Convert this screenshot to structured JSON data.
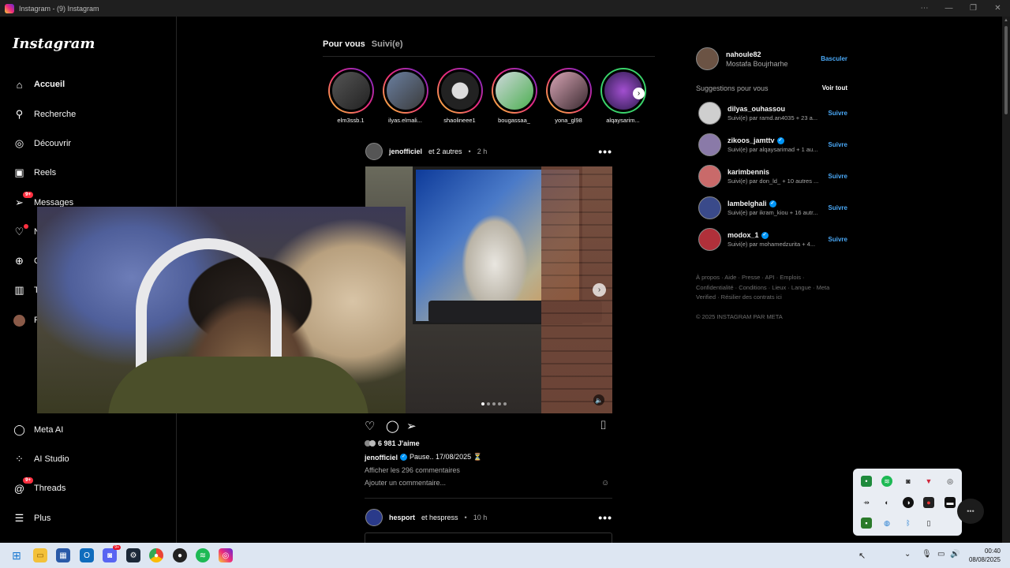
{
  "window": {
    "title": "Instagram - (9) Instagram"
  },
  "brand": {
    "logo": "Instagram",
    "accent": "#0095f6",
    "badge_color": "#ff3040"
  },
  "nav": {
    "items": [
      {
        "label": "Accueil",
        "icon": "home-icon"
      },
      {
        "label": "Recherche",
        "icon": "search-icon"
      },
      {
        "label": "Découvrir",
        "icon": "compass-icon"
      },
      {
        "label": "Reels",
        "icon": "reels-icon"
      },
      {
        "label": "Messages",
        "icon": "messages-icon",
        "badge": "9+"
      },
      {
        "label": "N",
        "icon": "heart-icon"
      },
      {
        "label": "C",
        "icon": "create-icon"
      },
      {
        "label": "T",
        "icon": "dashboard-icon"
      },
      {
        "label": "P",
        "icon": "profile-avatar"
      }
    ],
    "bottom": [
      {
        "label": "Meta AI",
        "icon": "meta-ai-icon"
      },
      {
        "label": "AI Studio",
        "icon": "ai-studio-icon"
      },
      {
        "label": "Threads",
        "icon": "threads-icon",
        "badge": "9+"
      },
      {
        "label": "Plus",
        "icon": "menu-icon"
      }
    ]
  },
  "feed": {
    "tabs": [
      "Pour vous",
      "Suivi(e)"
    ],
    "stories": [
      "elm3ssb.1",
      "ilyas.elmali...",
      "shaolineee1",
      "bougassaa_",
      "yona_gl98",
      "alqaysarim..."
    ],
    "post": {
      "user": "jenofficiel",
      "coauthors": "et 2 autres",
      "time": "2 h",
      "likes": "6 981 J'aime",
      "caption_user": "jenofficiel",
      "caption": "Pause.. 17/08/2025 ⏳",
      "comments_link": "Afficher les 296 commentaires",
      "add_comment_placeholder": "Ajouter un commentaire..."
    },
    "post2": {
      "user": "hesport",
      "coauthors": "et hespress",
      "time": "10 h"
    }
  },
  "sidebar_right": {
    "me": {
      "handle": "nahoule82",
      "name": "Mostafa Boujrharhe",
      "switch": "Basculer"
    },
    "suggestions_title": "Suggestions pour vous",
    "see_all": "Voir tout",
    "follow_label": "Suivre",
    "suggestions": [
      {
        "handle": "dilyas_ouhassou",
        "verified": false,
        "sub": "Suivi(e) par ramd.an4035 + 23 a..."
      },
      {
        "handle": "zikoos_jamttv",
        "verified": true,
        "sub": "Suivi(e) par alqaysarimad + 1 au..."
      },
      {
        "handle": "karimbennis",
        "verified": false,
        "sub": "Suivi(e) par don_ld_ + 10 autres ..."
      },
      {
        "handle": "lambelghali",
        "verified": true,
        "sub": "Suivi(e) par ikram_kiou + 16 autr..."
      },
      {
        "handle": "modox_1",
        "verified": true,
        "sub": "Suivi(e) par mohamedzurita + 4..."
      }
    ],
    "footer": "À propos · Aide · Presse · API · Emplois · Confidentialité · Conditions · Lieux · Langue · Meta Verified · Résilier des contrats ici",
    "copyright": "© 2025 INSTAGRAM PAR META"
  },
  "taskbar": {
    "apps": [
      "windows-start",
      "file-explorer",
      "store",
      "outlook",
      "discord",
      "steam",
      "chrome",
      "app-dark",
      "spotify",
      "instagram"
    ],
    "discord_badge": "9+",
    "time": "00:40",
    "date": "08/08/2025"
  }
}
